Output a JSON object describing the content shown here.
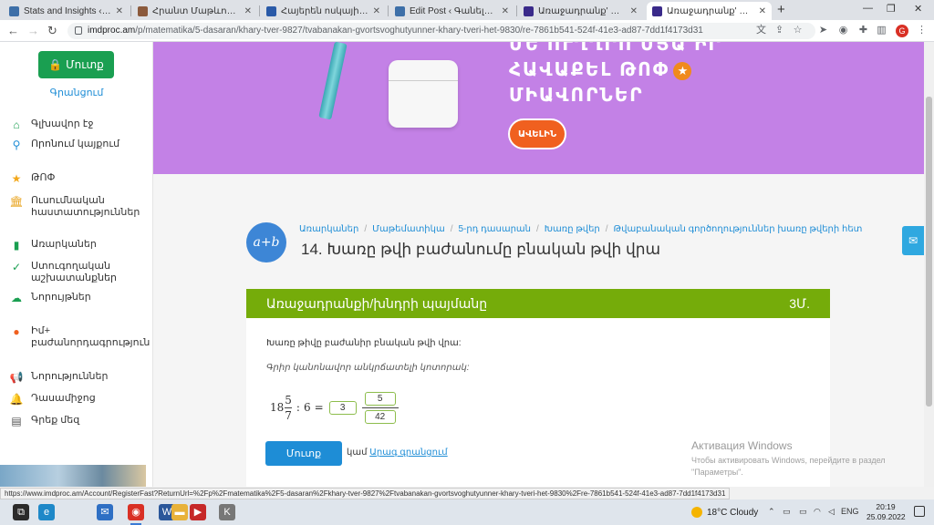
{
  "tabs": [
    {
      "title": "Stats and Insights ‹ Գանելի",
      "icon_color": "#3d6fa8"
    },
    {
      "title": "Հրանտ Մաթևոսյան «Հաց»",
      "icon_color": "#8b5a3c"
    },
    {
      "title": "Հայերեն ոսկային բառարան",
      "icon_color": "#2a5aa8"
    },
    {
      "title": "Edit Post ‹ Գանելի Բարձր",
      "icon_color": "#3d6fa8"
    },
    {
      "title": "Առաջադրանք' Խառը թվի",
      "icon_color": "#3a2a8a"
    },
    {
      "title": "Առաջադրանք' Խառը թվի",
      "icon_color": "#3a2a8a"
    }
  ],
  "window_controls": {
    "minimize": "—",
    "restore": "❐",
    "close": "✕"
  },
  "browser": {
    "url_host": "imdproc.am",
    "url_path": "/p/matematika/5-dasaran/khary-tver-9827/tvabanakan-gvortsvoghutyunner-khary-tveri-het-9830/re-7861b541-524f-41e3-ad87-7dd1f4173d31",
    "profile_initial": "G"
  },
  "sidebar": {
    "signin_label": "Մուտք",
    "register_label": "Գրանցում",
    "items": [
      {
        "icon": "home-icon",
        "glyph": "⌂",
        "color": "#1a9f51",
        "label": "Գլխավոր էջ"
      },
      {
        "icon": "search-icon",
        "glyph": "⚲",
        "color": "#1e8dd6",
        "label": "Որոնում կայքում"
      },
      {
        "icon": "star-icon",
        "glyph": "★",
        "color": "#f3a81c",
        "label": "ԹՈՓ"
      },
      {
        "icon": "institution-icon",
        "glyph": "🏛",
        "color": "#e8a21a",
        "label": "Ուսումնական հաստատություններ"
      },
      {
        "icon": "book-icon",
        "glyph": "▮",
        "color": "#1a9f51",
        "label": "Առարկաներ"
      },
      {
        "icon": "check-circle-icon",
        "glyph": "✓",
        "color": "#1a9f51",
        "label": "Ստուգողական աշխատանքներ"
      },
      {
        "icon": "cloud-upload-icon",
        "glyph": "☁",
        "color": "#1a9f51",
        "label": "Նորույթներ"
      },
      {
        "icon": "mix-badge-icon",
        "glyph": "●",
        "color": "#f0601f",
        "label": "Իմ+ բաժանորդագրություն"
      },
      {
        "icon": "megaphone-icon",
        "glyph": "📢",
        "color": "#555555",
        "label": "Նորություններ"
      },
      {
        "icon": "bell-icon",
        "glyph": "🔔",
        "color": "#555555",
        "label": "Դասամիջոց"
      },
      {
        "icon": "chat-icon",
        "glyph": "▤",
        "color": "#555555",
        "label": "Գրեք մեզ"
      }
    ]
  },
  "banner": {
    "line1": "ՄԵ ՈՒՂՂՐՈ ՄՅԱ ԻՐ",
    "line2": "ՀԱՎԱՔԵԼ ԹՈՓ",
    "line3": "ՄԻԱՎՈՐՆԵՐ",
    "more_label": "ԱՎԵԼԻՆ"
  },
  "lesson": {
    "icon_text": "a+b",
    "breadcrumbs": [
      "Առարկաներ",
      "Մաթեմատիկա",
      "5-րդ դասարան",
      "Խառը թվեր",
      "Թվաբանական գործողություններ խառը թվերի հետ"
    ],
    "title": "14. Խառը թվի բաժանումը բնական թվի վրա"
  },
  "task": {
    "header": "Առաջադրանքի/խնդրի պայմանը",
    "points": "3Մ.",
    "question": "Խառը թիվը բաժանիր բնական թվի վրա:",
    "instruction": "Գրիր կանոնավոր անկրճատելի կոտորակ:",
    "expr": {
      "whole": "18",
      "num": "5",
      "den": "7",
      "op": ":",
      "divisor": "6",
      "eq": "="
    },
    "answer_whole": "3",
    "answer_num": "5",
    "answer_den": "42",
    "answer_button": "Մուտք",
    "or_text": "կամ",
    "quick_register": "Արագ գրանցում"
  },
  "watermark": {
    "title": "Активация Windows",
    "body": "Чтобы активировать Windows, перейдите в раздел \"Параметры\"."
  },
  "status_url": "https://www.imdproc.am/Account/RegisterFast?ReturnUrl=%2Fp%2Fmatematika%2F5-dasaran%2Fkhary-tver-9827%2Ftvabanakan-gvortsvoghutyunner-khary-tveri-het-9830%2Fre-7861b541-524f-41e3-ad87-7dd1f4173d31",
  "taskbar": {
    "apps": [
      {
        "name": "task-view-icon",
        "glyph": "⧉",
        "color": "#2b2b2b"
      },
      {
        "name": "edge-icon",
        "glyph": "e",
        "color": "#1e88c8"
      },
      {
        "name": "mail-icon",
        "glyph": "✉",
        "color": "#2e6fc4"
      },
      {
        "name": "chrome-icon",
        "glyph": "◉",
        "color": "#d93025"
      },
      {
        "name": "word-icon",
        "glyph": "W",
        "color": "#2b579a"
      },
      {
        "name": "explorer-icon",
        "glyph": "▬",
        "color": "#e8b23a"
      },
      {
        "name": "media-icon",
        "glyph": "▶",
        "color": "#c62828"
      },
      {
        "name": "app-k-icon",
        "glyph": "K",
        "color": "#777777"
      }
    ],
    "weather": "18°C Cloudy",
    "lang": "ENG",
    "time": "20:19",
    "date": "25.09.2022"
  }
}
